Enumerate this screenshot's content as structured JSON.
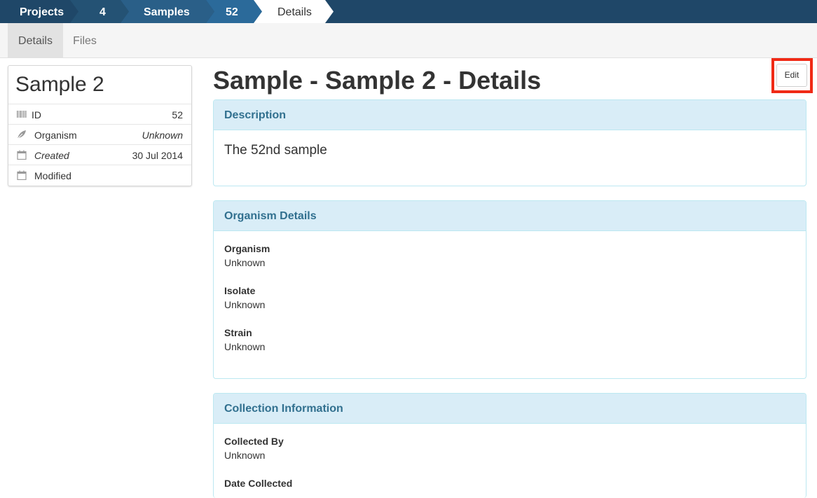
{
  "breadcrumb": [
    {
      "label": "Projects"
    },
    {
      "label": "4"
    },
    {
      "label": "Samples"
    },
    {
      "label": "52"
    },
    {
      "label": "Details"
    }
  ],
  "tabs": [
    {
      "label": "Details",
      "active": true
    },
    {
      "label": "Files",
      "active": false
    }
  ],
  "sidebar": {
    "title": "Sample 2",
    "rows": [
      {
        "icon": "barcode-icon",
        "label": "ID",
        "value": "52"
      },
      {
        "icon": "leaf-icon",
        "label": "Organism",
        "value": "Unknown"
      },
      {
        "icon": "calendar-icon",
        "label": "Created",
        "value": "30 Jul 2014"
      },
      {
        "icon": "calendar-icon",
        "label": "Modified",
        "value": ""
      }
    ]
  },
  "main": {
    "title": "Sample - Sample 2 - Details",
    "edit_label": "Edit",
    "description": {
      "heading": "Description",
      "text": "The 52nd sample"
    },
    "organism": {
      "heading": "Organism Details",
      "fields": [
        {
          "label": "Organism",
          "value": "Unknown"
        },
        {
          "label": "Isolate",
          "value": "Unknown"
        },
        {
          "label": "Strain",
          "value": "Unknown"
        }
      ]
    },
    "collection": {
      "heading": "Collection Information",
      "fields": [
        {
          "label": "Collected By",
          "value": "Unknown"
        },
        {
          "label": "Date Collected",
          "value": ""
        }
      ]
    }
  },
  "colors": {
    "crumb_dark": "#1f4768",
    "crumb_mid": "#2a6393",
    "crumb_active": "#ffffff",
    "panel_head_bg": "#d9edf7",
    "panel_head_text": "#31708f",
    "highlight": "#f02a16"
  }
}
